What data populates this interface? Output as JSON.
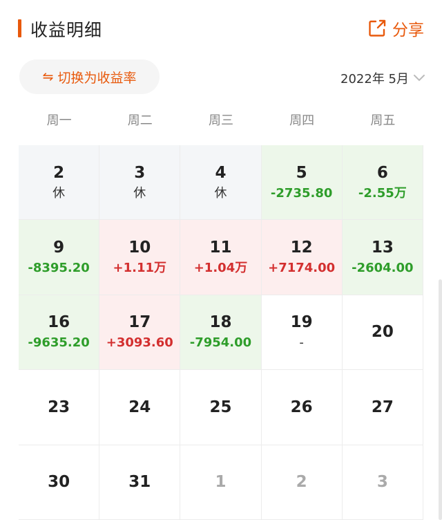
{
  "header": {
    "title": "收益明细",
    "share_label": "分享"
  },
  "controls": {
    "switch_label": "切换为收益率",
    "switch_icon": "swap-arrows-icon",
    "month_label": "2022年 5月"
  },
  "colors": {
    "accent": "#e8590c",
    "gain": "#d32f2f",
    "loss": "#2e9d2a"
  },
  "weekdays": [
    "周一",
    "周二",
    "周三",
    "周四",
    "周五"
  ],
  "calendar": [
    {
      "day": "2",
      "value": "休",
      "type": "rest"
    },
    {
      "day": "3",
      "value": "休",
      "type": "rest"
    },
    {
      "day": "4",
      "value": "休",
      "type": "rest"
    },
    {
      "day": "5",
      "value": "-2735.80",
      "type": "neg"
    },
    {
      "day": "6",
      "value": "-2.55万",
      "type": "neg"
    },
    {
      "day": "9",
      "value": "-8395.20",
      "type": "neg"
    },
    {
      "day": "10",
      "value": "+1.11万",
      "type": "pos"
    },
    {
      "day": "11",
      "value": "+1.04万",
      "type": "pos"
    },
    {
      "day": "12",
      "value": "+7174.00",
      "type": "pos"
    },
    {
      "day": "13",
      "value": "-2604.00",
      "type": "neg"
    },
    {
      "day": "16",
      "value": "-9635.20",
      "type": "neg"
    },
    {
      "day": "17",
      "value": "+3093.60",
      "type": "pos"
    },
    {
      "day": "18",
      "value": "-7954.00",
      "type": "neg"
    },
    {
      "day": "19",
      "value": "-",
      "type": "plain"
    },
    {
      "day": "20",
      "value": "",
      "type": "plain"
    },
    {
      "day": "23",
      "value": "",
      "type": "plain"
    },
    {
      "day": "24",
      "value": "",
      "type": "plain"
    },
    {
      "day": "25",
      "value": "",
      "type": "plain"
    },
    {
      "day": "26",
      "value": "",
      "type": "plain"
    },
    {
      "day": "27",
      "value": "",
      "type": "plain"
    },
    {
      "day": "30",
      "value": "",
      "type": "plain"
    },
    {
      "day": "31",
      "value": "",
      "type": "plain"
    },
    {
      "day": "1",
      "value": "",
      "type": "other"
    },
    {
      "day": "2",
      "value": "",
      "type": "other"
    },
    {
      "day": "3",
      "value": "",
      "type": "other"
    }
  ]
}
